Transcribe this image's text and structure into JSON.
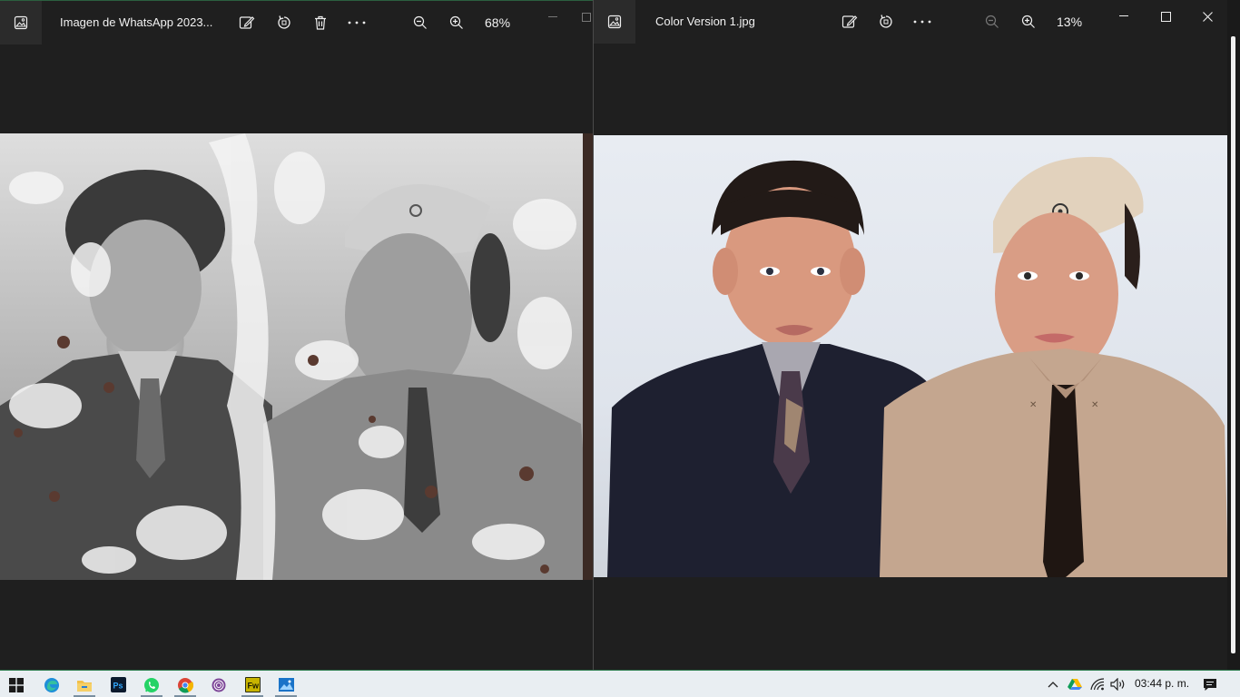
{
  "left_window": {
    "title": "Imagen de WhatsApp 2023...",
    "zoom": "68%",
    "toolbar_icons": [
      "edit-image-icon",
      "rotate-icon",
      "delete-icon",
      "more-icon",
      "zoom-out-icon",
      "zoom-in-icon"
    ]
  },
  "right_window": {
    "title": "Color Version 1.jpg",
    "zoom": "13%",
    "toolbar_icons": [
      "edit-image-icon",
      "rotate-icon",
      "more-icon",
      "zoom-out-icon",
      "zoom-in-icon"
    ],
    "window_controls": [
      "minimize",
      "maximize",
      "close"
    ]
  },
  "taskbar": {
    "apps": [
      "start",
      "edge",
      "file-explorer",
      "photoshop",
      "whatsapp",
      "chrome",
      "tor-browser",
      "fireworks",
      "photos"
    ],
    "tray_icons": [
      "chevron-up-icon",
      "google-drive-icon",
      "wifi-icon",
      "speaker-icon"
    ],
    "clock": "03:44 p. m.",
    "notification_icon": "notification-icon"
  },
  "colors": {
    "window_bg": "#1f1f1f",
    "taskbar_bg": "#e9eef2",
    "accent_green": "#2f7d4f",
    "suit_dark": "#1e2030",
    "uniform_khaki": "#c4a68f"
  }
}
